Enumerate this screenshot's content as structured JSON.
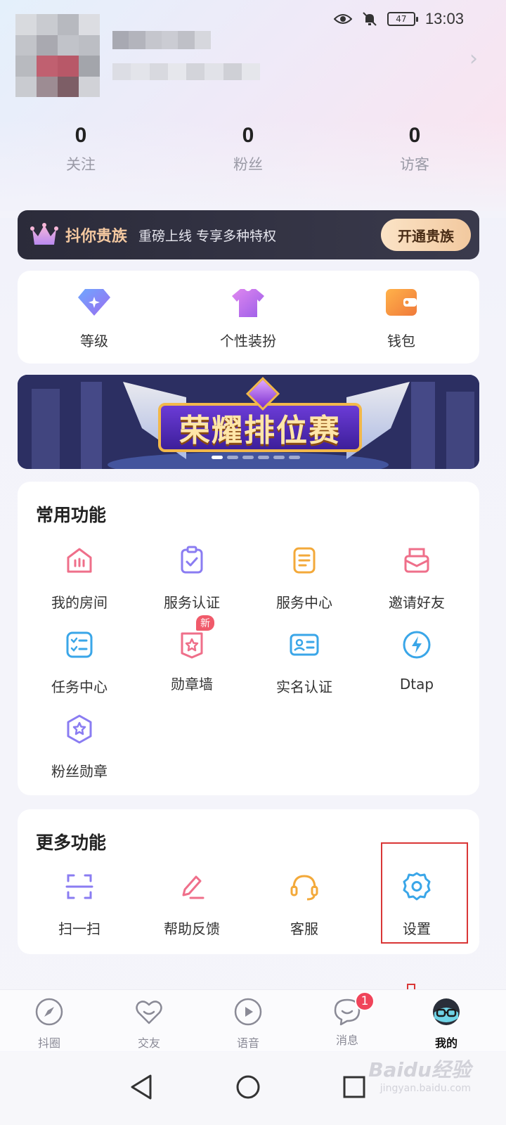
{
  "status_bar": {
    "time": "13:03",
    "battery": "47"
  },
  "stats": [
    {
      "value": "0",
      "label": "关注"
    },
    {
      "value": "0",
      "label": "粉丝"
    },
    {
      "value": "0",
      "label": "访客"
    }
  ],
  "noble": {
    "title": "抖你贵族",
    "subtitle": "重磅上线 专享多种特权",
    "button": "开通贵族"
  },
  "quick": [
    {
      "label": "等级",
      "icon": "level-diamond-icon"
    },
    {
      "label": "个性装扮",
      "icon": "tshirt-icon"
    },
    {
      "label": "钱包",
      "icon": "wallet-icon"
    }
  ],
  "banner": {
    "title": "荣耀排位赛",
    "slides": 6,
    "active_slide": 1
  },
  "common": {
    "title": "常用功能",
    "items": [
      {
        "label": "我的房间",
        "icon": "room-icon",
        "color": "#ef6f8a"
      },
      {
        "label": "服务认证",
        "icon": "clipboard-check-icon",
        "color": "#8a7cf2"
      },
      {
        "label": "服务中心",
        "icon": "document-icon",
        "color": "#f3a93a"
      },
      {
        "label": "邀请好友",
        "icon": "invite-mail-icon",
        "color": "#ef6f8a"
      },
      {
        "label": "任务中心",
        "icon": "task-list-icon",
        "color": "#3aa6e8"
      },
      {
        "label": "勋章墙",
        "icon": "medal-star-icon",
        "color": "#ef6f8a",
        "badge": "新"
      },
      {
        "label": "实名认证",
        "icon": "id-card-icon",
        "color": "#3aa6e8"
      },
      {
        "label": "Dtap",
        "icon": "lightning-icon",
        "color": "#3aa6e8"
      },
      {
        "label": "粉丝勋章",
        "icon": "fan-badge-icon",
        "color": "#8a7cf2"
      }
    ]
  },
  "more": {
    "title": "更多功能",
    "items": [
      {
        "label": "扫一扫",
        "icon": "scan-icon",
        "color": "#8a7cf2"
      },
      {
        "label": "帮助反馈",
        "icon": "pencil-icon",
        "color": "#ef6f8a"
      },
      {
        "label": "客服",
        "icon": "headset-icon",
        "color": "#f3a93a"
      },
      {
        "label": "设置",
        "icon": "gear-icon",
        "color": "#3aa6e8"
      }
    ]
  },
  "tabs": [
    {
      "label": "抖圈",
      "icon": "compass-icon"
    },
    {
      "label": "交友",
      "icon": "heart-icon"
    },
    {
      "label": "语音",
      "icon": "play-icon"
    },
    {
      "label": "消息",
      "icon": "chat-icon",
      "badge": "1"
    },
    {
      "label": "我的",
      "icon": "avatar-icon",
      "active": true
    }
  ],
  "watermark": {
    "brand": "Baidu经验",
    "domain": "jingyan.baidu.com"
  }
}
